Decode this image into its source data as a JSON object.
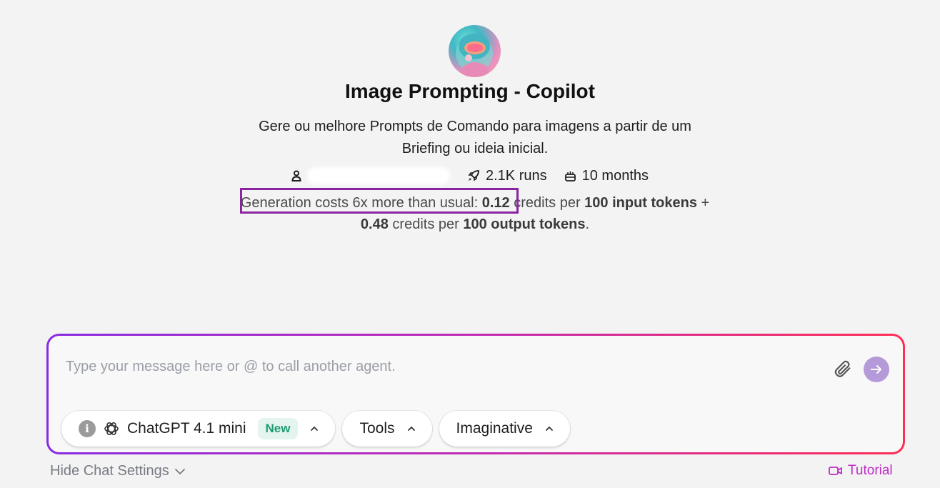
{
  "agent": {
    "title": "Image Prompting - Copilot",
    "description": "Gere ou melhore Prompts de Comando para imagens a partir de um Briefing ou ideia inicial.",
    "author_icon": "user-icon",
    "runs": "2.1K runs",
    "runs_icon": "rocket-icon",
    "age": "10 months",
    "age_icon": "cake-icon"
  },
  "cost": {
    "intro": "Generation costs 6x more than usual:",
    "input_rate": "0.12",
    "credits_per_1": "credits per",
    "input_unit": "100 input tokens",
    "plus": "+",
    "output_rate": "0.48",
    "credits_per_2": "credits per",
    "output_unit": "100 output tokens",
    "end": "."
  },
  "composer": {
    "placeholder": "Type your message here or @ to call another agent.",
    "attach_icon": "paperclip-icon",
    "send_icon": "arrow-right-icon"
  },
  "chips": {
    "model_label": "ChatGPT 4.1 mini",
    "model_badge": "New",
    "tools_label": "Tools",
    "style_label": "Imaginative"
  },
  "footer": {
    "hide_settings": "Hide Chat Settings",
    "tutorial": "Tutorial"
  },
  "colors": {
    "highlight_border": "#8a24a0",
    "gradient_start": "#8a2be2",
    "gradient_end": "#ff2d55",
    "send_button": "#b49ad9",
    "tutorial": "#c02bc6",
    "new_badge_text": "#1f9b73"
  }
}
